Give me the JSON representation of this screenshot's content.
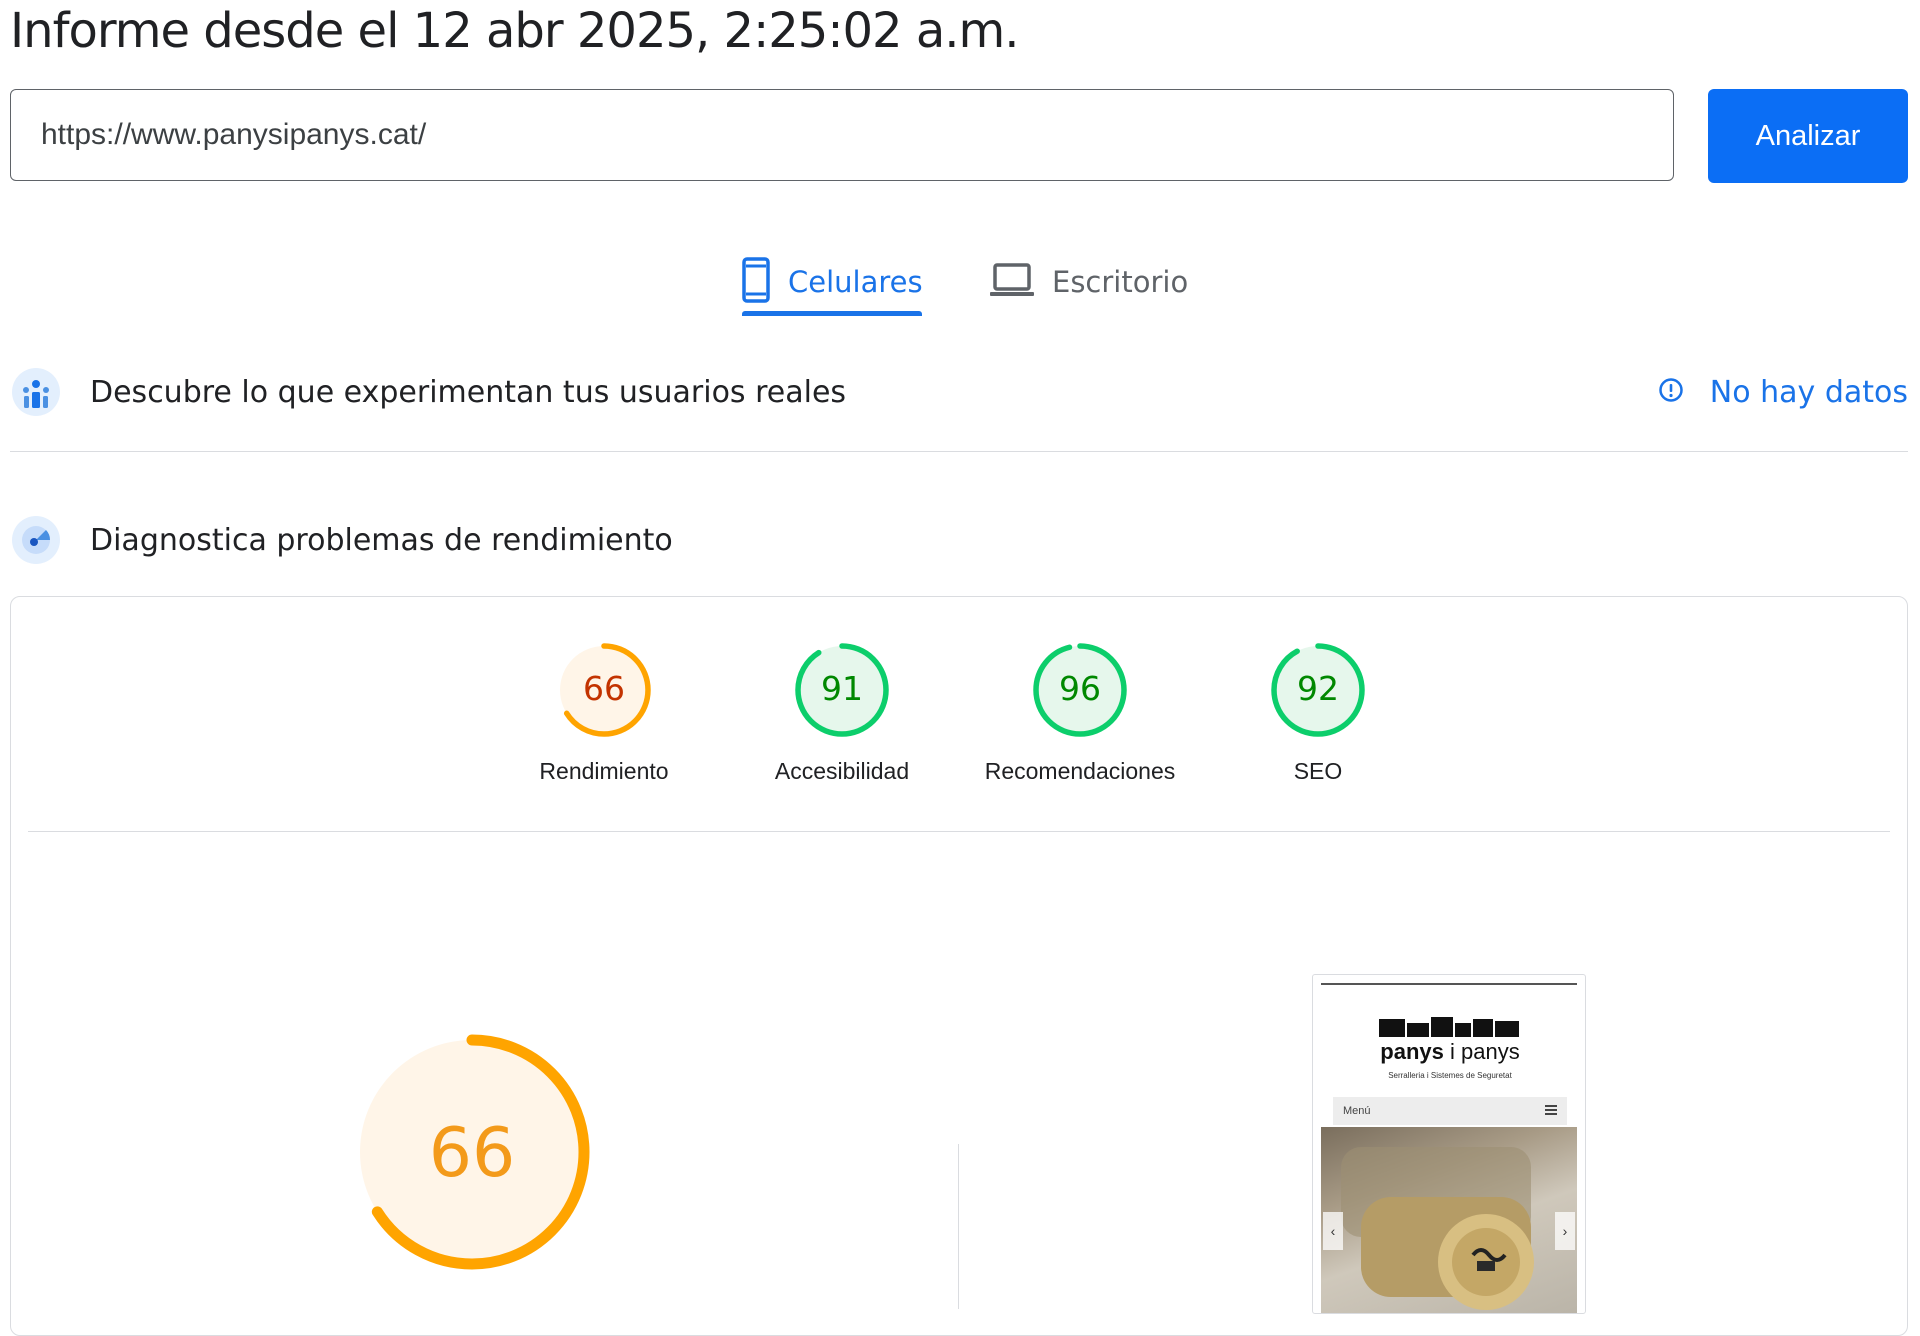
{
  "header": {
    "report_title": "Informe desde el 12 abr 2025, 2:25:02 a.m."
  },
  "search": {
    "url_value": "https://www.panysipanys.cat/",
    "analyze_label": "Analizar"
  },
  "tabs": {
    "items": [
      {
        "label": "Celulares",
        "icon": "smartphone-icon",
        "active": true
      },
      {
        "label": "Escritorio",
        "icon": "laptop-icon",
        "active": false
      }
    ]
  },
  "crux_section": {
    "title": "Descubre lo que experimentan tus usuarios reales",
    "status_label": "No hay datos",
    "status_icon": "info-icon"
  },
  "lab_section": {
    "title": "Diagnostica problemas de rendimiento"
  },
  "scores": [
    {
      "label": "Rendimiento",
      "value": 66,
      "rating": "average"
    },
    {
      "label": "Accesibilidad",
      "value": 91,
      "rating": "pass"
    },
    {
      "label": "Recomendaciones",
      "value": 96,
      "rating": "pass"
    },
    {
      "label": "SEO",
      "value": 92,
      "rating": "pass"
    }
  ],
  "performance": {
    "score": 66
  },
  "page_screenshot": {
    "brand_bold": "panys",
    "brand_rest": "i panys",
    "tagline": "Serralleria i Sistemes de Seguretat",
    "menu_label": "Menú",
    "arrow_left": "‹",
    "arrow_right": "›"
  },
  "colors": {
    "accent_blue": "#1a73e8",
    "button_blue": "#0b6ef5",
    "average_orange": "#ffa400",
    "average_text": "#c33300",
    "pass_green": "#0cce6b",
    "pass_text": "#008800"
  }
}
